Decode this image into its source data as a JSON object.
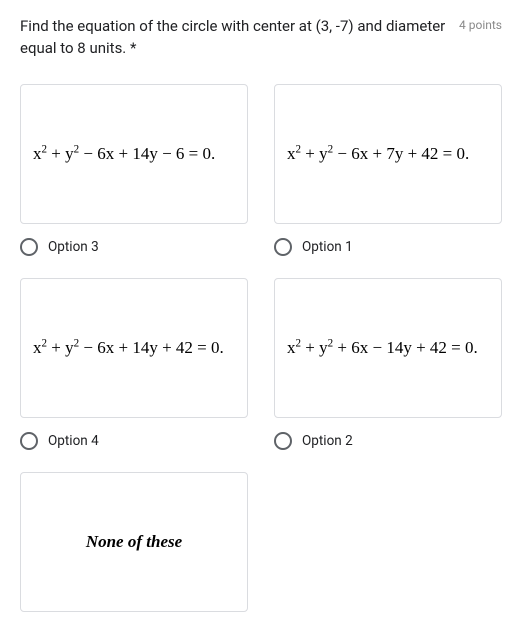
{
  "question": {
    "text": "Find the equation of the circle with center at (3, -7) and diameter equal to 8 units. *",
    "points": "4 points"
  },
  "options": {
    "a": {
      "formula_html": "x<sup>2</sup> + y<sup>2</sup> − 6x + 14y − 6 = 0.",
      "label": "Option 3"
    },
    "b": {
      "formula_html": "x<sup>2</sup> + y<sup>2</sup> − 6x + 7y + 42 = 0.",
      "label": "Option 1"
    },
    "c": {
      "formula_html": "x<sup>2</sup> + y<sup>2</sup> − 6x + 14y + 42 = 0.",
      "label": "Option 4"
    },
    "d": {
      "formula_html": "x<sup>2</sup> + y<sup>2</sup> + 6x − 14y + 42 = 0.",
      "label": "Option 2"
    },
    "e": {
      "formula_text": "None of these"
    }
  }
}
